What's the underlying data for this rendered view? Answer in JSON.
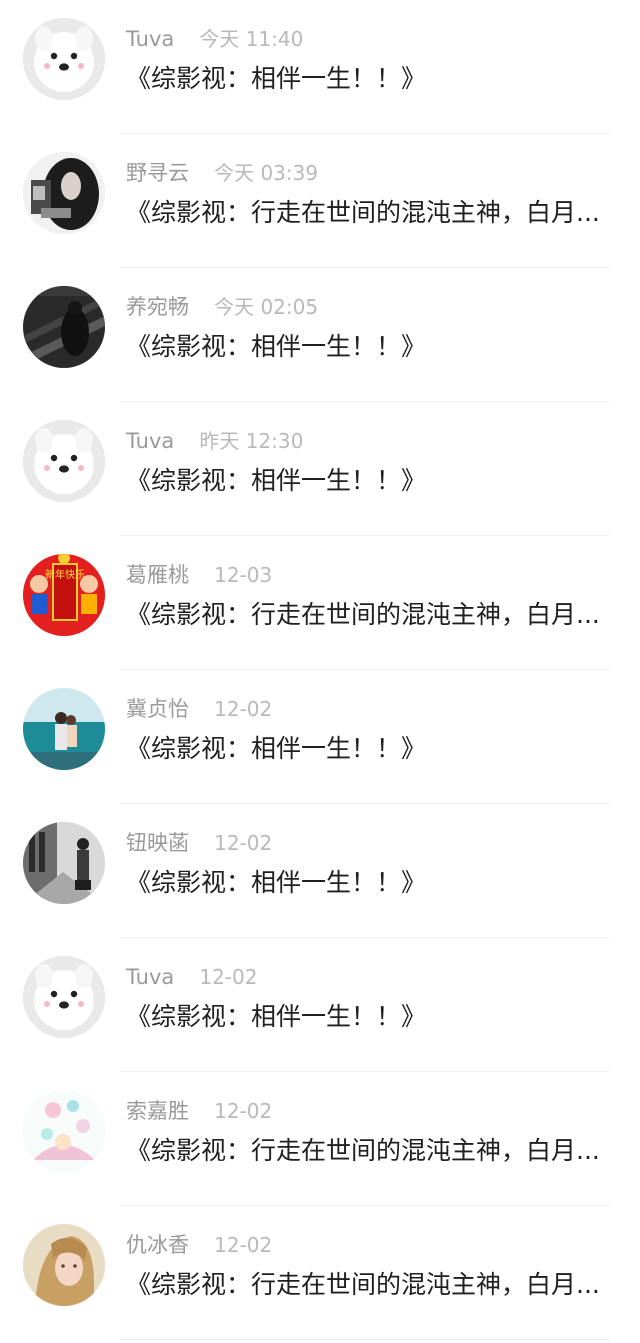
{
  "comments": [
    {
      "name": "Tuva",
      "time": "今天 11:40",
      "text": "《综影视：相伴一生！！》",
      "avatar": "samoyed-dog"
    },
    {
      "name": "野寻云",
      "time": "今天 03:39",
      "text": "《综影视：行走在世间的混沌主神，白月...",
      "avatar": "dark-hair-woman"
    },
    {
      "name": "养宛畅",
      "time": "今天 02:05",
      "text": "《综影视：相伴一生！！》",
      "avatar": "railway-dark"
    },
    {
      "name": "Tuva",
      "time": "昨天 12:30",
      "text": "《综影视：相伴一生！！》",
      "avatar": "samoyed-dog"
    },
    {
      "name": "葛雁桃",
      "time": "12-03",
      "text": "《综影视：行走在世间的混沌主神，白月...",
      "avatar": "new-year-kids"
    },
    {
      "name": "冀贞怡",
      "time": "12-02",
      "text": "《综影视：相伴一生！！》",
      "avatar": "beach-couple"
    },
    {
      "name": "钮映菡",
      "time": "12-02",
      "text": "《综影视：相伴一生！！》",
      "avatar": "street-bw"
    },
    {
      "name": "Tuva",
      "time": "12-02",
      "text": "《综影视：相伴一生！！》",
      "avatar": "samoyed-dog"
    },
    {
      "name": "索嘉胜",
      "time": "12-02",
      "text": "《综影视：行走在世间的混沌主神，白月...",
      "avatar": "pastel-flowers"
    },
    {
      "name": "仇冰香",
      "time": "12-02",
      "text": "《综影视：行走在世间的混沌主神，白月...",
      "avatar": "blonde-girl"
    }
  ],
  "avatar_badge_text": {
    "new_year": "新年快乐"
  }
}
